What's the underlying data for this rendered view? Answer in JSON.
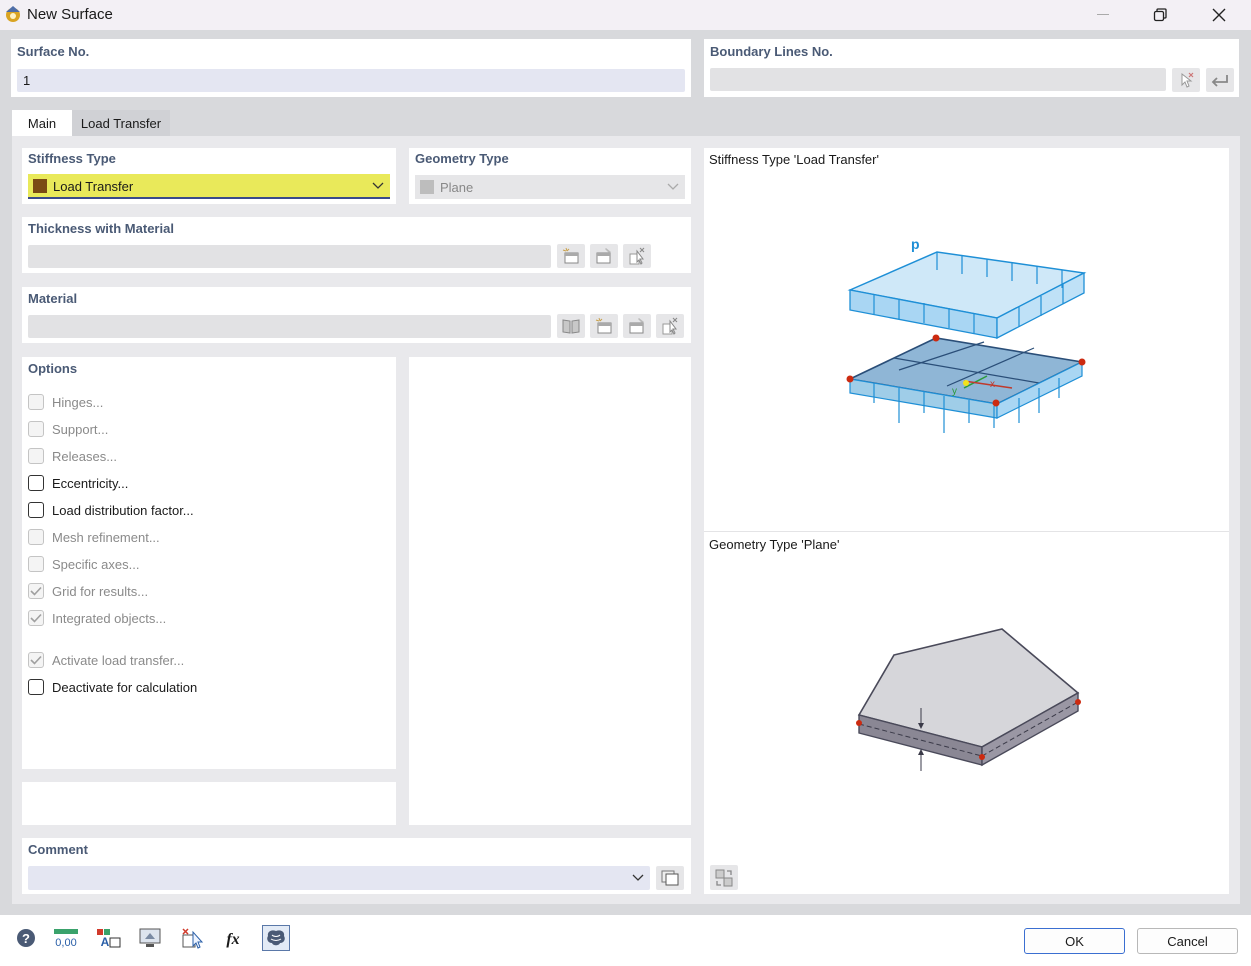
{
  "window": {
    "title": "New Surface",
    "icon": "rfem-app-icon"
  },
  "surface_no": {
    "label": "Surface No.",
    "value": "1"
  },
  "boundary_lines": {
    "label": "Boundary Lines No.",
    "value": ""
  },
  "tabs": [
    {
      "label": "Main",
      "active": true
    },
    {
      "label": "Load Transfer",
      "active": false
    }
  ],
  "stiffness_type": {
    "label": "Stiffness Type",
    "value": "Load Transfer",
    "swatch_color": "#7a4a14",
    "highlight_color": "#e9e95a"
  },
  "geometry_type": {
    "label": "Geometry Type",
    "value": "Plane"
  },
  "thickness": {
    "label": "Thickness with Material",
    "value": ""
  },
  "material": {
    "label": "Material",
    "value": ""
  },
  "options": {
    "label": "Options",
    "items": [
      {
        "label": "Hinges...",
        "checked": false,
        "enabled": false
      },
      {
        "label": "Support...",
        "checked": false,
        "enabled": false
      },
      {
        "label": "Releases...",
        "checked": false,
        "enabled": false
      },
      {
        "label": "Eccentricity...",
        "checked": false,
        "enabled": true
      },
      {
        "label": "Load distribution factor...",
        "checked": false,
        "enabled": true
      },
      {
        "label": "Mesh refinement...",
        "checked": false,
        "enabled": false
      },
      {
        "label": "Specific axes...",
        "checked": false,
        "enabled": false
      },
      {
        "label": "Grid for results...",
        "checked": true,
        "enabled": false
      },
      {
        "label": "Integrated objects...",
        "checked": true,
        "enabled": false
      },
      {
        "label": "Activate load transfer...",
        "checked": true,
        "enabled": false
      },
      {
        "label": "Deactivate for calculation",
        "checked": false,
        "enabled": true
      }
    ]
  },
  "comment": {
    "label": "Comment",
    "value": ""
  },
  "illustrations": {
    "stiffness_caption": "Stiffness Type 'Load Transfer'",
    "load_label": "p",
    "axis_x": "x",
    "axis_y": "y",
    "geometry_caption": "Geometry Type 'Plane'"
  },
  "footer": {
    "ok_label": "OK",
    "cancel_label": "Cancel"
  },
  "colors": {
    "accent_blue": "#1e8fd6",
    "section_label": "#4a5a75",
    "node_red": "#cc2a10"
  }
}
